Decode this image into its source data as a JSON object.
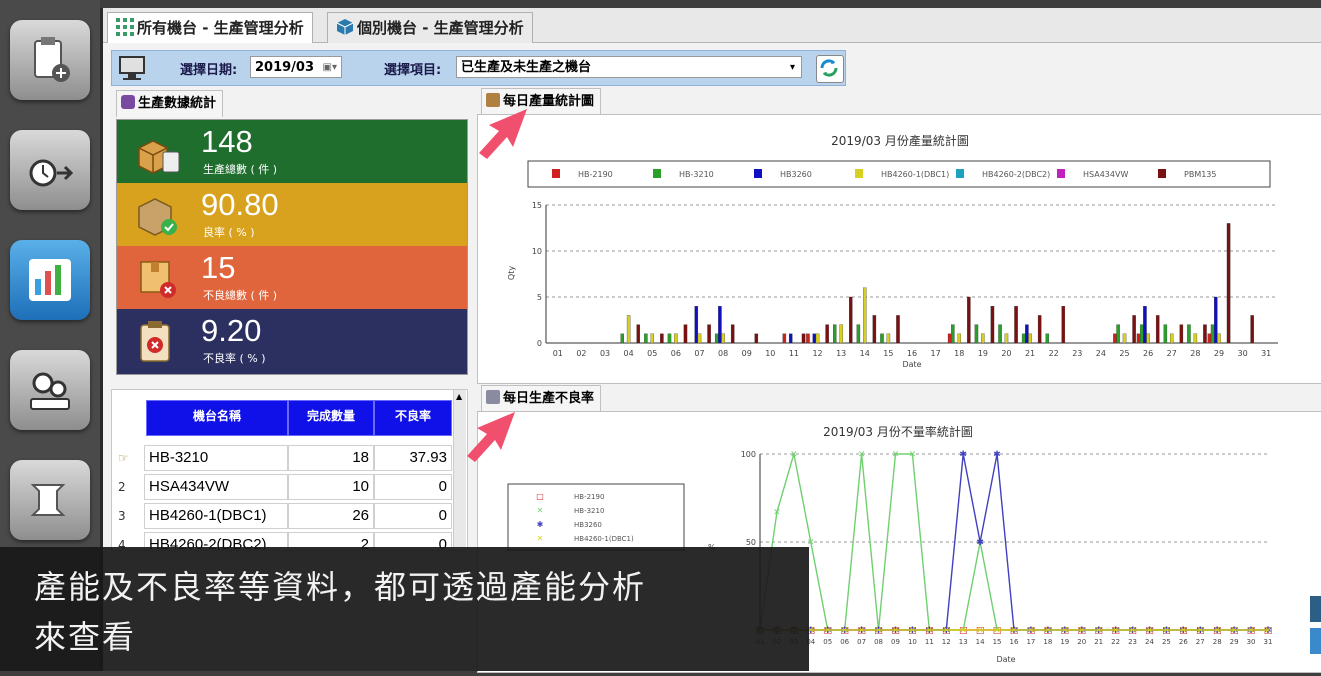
{
  "tabs": [
    {
      "label": "所有機台 - 生產管理分析",
      "active": true
    },
    {
      "label": "個別機台 - 生產管理分析",
      "active": false
    }
  ],
  "toolbar": {
    "date_label": "選擇日期:",
    "date_value": "2019/03",
    "item_label": "選擇項目:",
    "item_value": "已生產及未生產之機台"
  },
  "stats_tab": "生產數據統計",
  "stats": [
    {
      "value": "148",
      "label": "生產總數 ( 件 )",
      "color": "#1f6e2e",
      "icon": "boxes-icon"
    },
    {
      "value": "90.80",
      "label": "良率 ( % )",
      "color": "#d8a21e",
      "icon": "box-check-icon"
    },
    {
      "value": "15",
      "label": "不良總數 ( 件 )",
      "color": "#e0643c",
      "icon": "box-x-icon"
    },
    {
      "value": "9.20",
      "label": "不良率 ( % )",
      "color": "#2c3060",
      "icon": "clipboard-x-icon"
    }
  ],
  "table": {
    "headers": [
      "機台名稱",
      "完成數量",
      "不良率"
    ],
    "rows": [
      {
        "idx": "",
        "name": "HB-3210",
        "qty": "18",
        "rate": "37.93"
      },
      {
        "idx": "2",
        "name": "HSA434VW",
        "qty": "10",
        "rate": "0"
      },
      {
        "idx": "3",
        "name": "HB4260-1(DBC1)",
        "qty": "26",
        "rate": "0"
      },
      {
        "idx": "4",
        "name": "HB4260-2(DBC2)",
        "qty": "2",
        "rate": "0"
      }
    ]
  },
  "daily_tab": "每日產量統計圖",
  "defect_tab": "每日生產不良率",
  "chart_data": [
    {
      "type": "bar",
      "title": "2019/03 月份產量統計圖",
      "xlabel": "Date",
      "ylabel": "Qty",
      "ylim": [
        0,
        15
      ],
      "yticks": [
        0,
        5,
        10,
        15
      ],
      "legend_position": "top",
      "categories": [
        "01",
        "02",
        "03",
        "04",
        "05",
        "06",
        "07",
        "08",
        "09",
        "10",
        "11",
        "12",
        "13",
        "14",
        "15",
        "16",
        "17",
        "18",
        "19",
        "20",
        "21",
        "22",
        "23",
        "24",
        "25",
        "26",
        "27",
        "28",
        "29",
        "30",
        "31"
      ],
      "series": [
        {
          "name": "HB-2190",
          "color": "#d02020",
          "values": [
            0,
            0,
            0,
            0,
            0,
            0,
            0,
            0,
            0,
            0,
            1,
            1,
            0,
            0,
            0,
            0,
            0,
            1,
            0,
            0,
            0,
            0,
            0,
            0,
            1,
            1,
            0,
            0,
            1,
            0,
            0
          ]
        },
        {
          "name": "HB-3210",
          "color": "#2aa02a",
          "values": [
            0,
            0,
            0,
            1,
            1,
            1,
            0,
            1,
            0,
            0,
            0,
            0,
            2,
            2,
            1,
            0,
            0,
            2,
            2,
            2,
            1,
            1,
            0,
            0,
            2,
            2,
            2,
            2,
            2,
            0,
            0
          ]
        },
        {
          "name": "HB3260",
          "color": "#1010c0",
          "values": [
            0,
            0,
            0,
            0,
            0,
            0,
            4,
            4,
            0,
            0,
            1,
            1,
            0,
            0,
            0,
            0,
            0,
            0,
            0,
            0,
            2,
            0,
            0,
            0,
            0,
            4,
            0,
            0,
            5,
            0,
            0
          ]
        },
        {
          "name": "HB4260-1(DBC1)",
          "color": "#d8d020",
          "values": [
            0,
            0,
            0,
            3,
            1,
            1,
            1,
            1,
            0,
            0,
            0,
            1,
            2,
            6,
            1,
            0,
            0,
            1,
            1,
            1,
            1,
            0,
            0,
            0,
            1,
            1,
            1,
            1,
            1,
            0,
            0
          ]
        },
        {
          "name": "HB4260-2(DBC2)",
          "color": "#20a0c0",
          "values": [
            0,
            0,
            0,
            0,
            0,
            0,
            0,
            0,
            0,
            0,
            0,
            0,
            0,
            0,
            0,
            0,
            0,
            0,
            0,
            0,
            0,
            0,
            0,
            0,
            0,
            0,
            0,
            0,
            0,
            0,
            0
          ]
        },
        {
          "name": "HSA434VW",
          "color": "#c020c0",
          "values": [
            0,
            0,
            0,
            0,
            0,
            0,
            0,
            0,
            0,
            0,
            0,
            0,
            0,
            0,
            0,
            0,
            0,
            0,
            0,
            0,
            0,
            0,
            0,
            0,
            0,
            0,
            0,
            0,
            0,
            0,
            0
          ]
        },
        {
          "name": "PBM135",
          "color": "#7a1010",
          "values": [
            0,
            0,
            0,
            2,
            1,
            2,
            2,
            2,
            1,
            0,
            1,
            2,
            5,
            3,
            3,
            0,
            0,
            5,
            4,
            4,
            3,
            4,
            0,
            0,
            3,
            3,
            2,
            2,
            13,
            3,
            0
          ]
        }
      ]
    },
    {
      "type": "line",
      "title": "2019/03 月份不量率統計圖",
      "xlabel": "Date",
      "ylabel": "%",
      "ylim": [
        0,
        100
      ],
      "yticks": [
        50,
        100
      ],
      "legend_position": "left",
      "categories": [
        "01",
        "02",
        "03",
        "04",
        "05",
        "06",
        "07",
        "08",
        "09",
        "10",
        "11",
        "12",
        "13",
        "14",
        "15",
        "16",
        "17",
        "18",
        "19",
        "20",
        "21",
        "22",
        "23",
        "24",
        "25",
        "26",
        "27",
        "28",
        "29",
        "30",
        "31"
      ],
      "series": [
        {
          "name": "HB-2190",
          "color": "#d02020",
          "marker": "square",
          "values": [
            0,
            0,
            0,
            0,
            0,
            0,
            0,
            0,
            0,
            0,
            0,
            0,
            0,
            0,
            0,
            0,
            0,
            0,
            0,
            0,
            0,
            0,
            0,
            0,
            0,
            0,
            0,
            0,
            0,
            0,
            0
          ]
        },
        {
          "name": "HB-3210",
          "color": "#70d070",
          "marker": "x",
          "values": [
            0,
            67,
            100,
            50,
            0,
            0,
            100,
            0,
            100,
            100,
            0,
            0,
            0,
            50,
            0,
            0,
            0,
            0,
            0,
            0,
            0,
            0,
            0,
            0,
            0,
            0,
            0,
            0,
            0,
            0,
            0
          ]
        },
        {
          "name": "HB3260",
          "color": "#4040c0",
          "marker": "star",
          "values": [
            0,
            0,
            0,
            0,
            0,
            0,
            0,
            0,
            0,
            0,
            0,
            0,
            100,
            50,
            100,
            0,
            0,
            0,
            0,
            0,
            0,
            0,
            0,
            0,
            0,
            0,
            0,
            0,
            0,
            0,
            0
          ]
        },
        {
          "name": "HB4260-1(DBC1)",
          "color": "#d8d020",
          "marker": "x",
          "values": [
            0,
            0,
            0,
            0,
            0,
            0,
            0,
            0,
            0,
            0,
            0,
            0,
            0,
            0,
            0,
            0,
            0,
            0,
            0,
            0,
            0,
            0,
            0,
            0,
            0,
            0,
            0,
            0,
            0,
            0,
            0
          ]
        }
      ]
    }
  ],
  "caption": {
    "line1": "產能及不良率等資料，都可透過產能分析",
    "line2": "來查看"
  },
  "colors": {
    "table_header": "#1010e8",
    "toolbar": "#b9d3ec",
    "arrow": "#f0506e"
  }
}
